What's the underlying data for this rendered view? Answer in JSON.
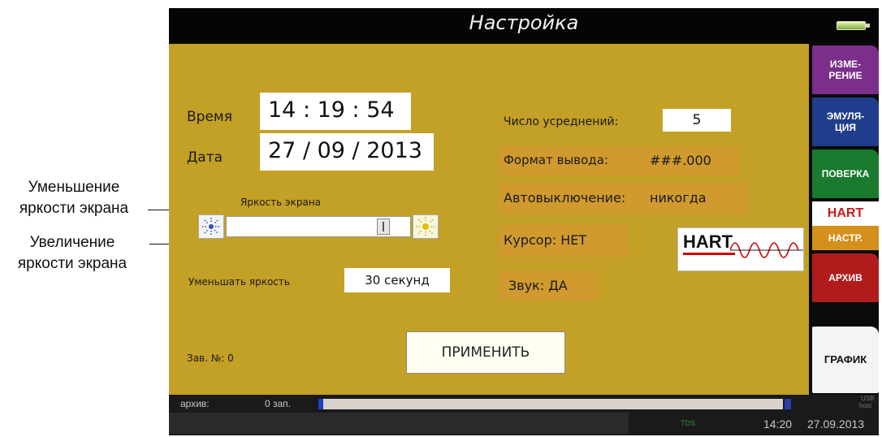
{
  "callouts": {
    "decrease": [
      "Уменьшение",
      "яркости экрана"
    ],
    "increase": [
      "Увеличение",
      "яркости экрана"
    ]
  },
  "screen": {
    "title": "Настройка",
    "time_label": "Время",
    "time_value": "14 : 19 : 54",
    "date_label": "Дата",
    "date_value": "27 / 09 / 2013",
    "brightness_label": "Яркость экрана",
    "brightness_level_percent": 88,
    "dim_label": "Уменьшать яркость",
    "dim_value": "30 секунд",
    "serial_label": "Зав. №: 0",
    "apply_button": "ПРИМЕНИТЬ",
    "averages_label": "Число усреднений:",
    "averages_value": "5",
    "format_label": "Формат вывода:",
    "format_value": "###.000",
    "autooff_label": "Автовыключение:",
    "autooff_value": "никогда",
    "cursor_text": "Курсор: НЕТ",
    "sound_text": "Звук: ДА",
    "hart_logo": "HART"
  },
  "tabs": [
    {
      "label": "ИЗМЕ-\nРЕНИЕ",
      "color": "#7b2e8a"
    },
    {
      "label": "ЭМУЛЯ-\nЦИЯ",
      "color": "#1f3d8c"
    },
    {
      "label": "ПОВЕРКА",
      "color": "#1a7a2e"
    },
    {
      "top": "HART",
      "label": "НАСТР.",
      "color": "#d58f1c"
    },
    {
      "label": "АРХИВ",
      "color": "#b01c1c"
    },
    {
      "label": "ГРАФИК",
      "color": "#f4f4f4"
    }
  ],
  "status": {
    "archive_label": "архив:",
    "records": "0 зап.",
    "archive_fill_percent": 1,
    "usb_line1": "USB",
    "usb_line2": "host",
    "mode": "TDS",
    "time": "14:20",
    "date": "27.09.2013"
  },
  "colors": {
    "panel": "#c3a026",
    "accent_orange": "#d58f1c"
  }
}
